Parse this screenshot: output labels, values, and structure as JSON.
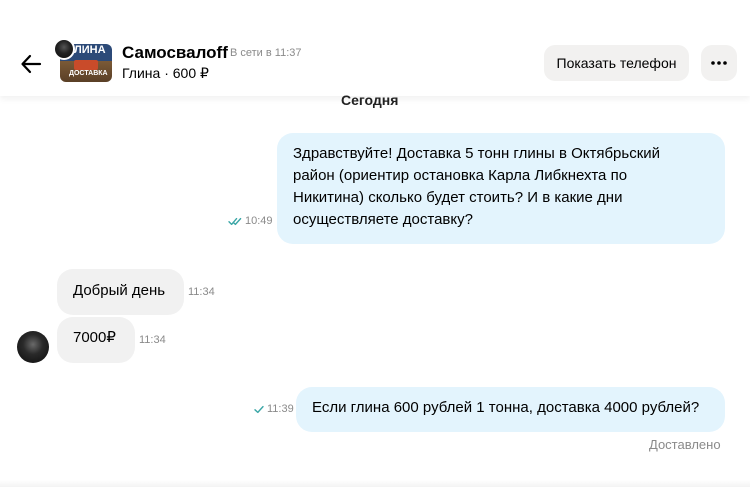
{
  "header": {
    "seller_name": "Самосвалоff",
    "online_status": "В сети в 11:37",
    "ad_info": "Глина · 600 ₽",
    "ad_thumb_title": "ЛИНА",
    "ad_thumb_subtitle": "ДОСТАВКА",
    "show_phone_label": "Показать телефон"
  },
  "chat": {
    "date_separator": "Сегодня",
    "messages": [
      {
        "direction": "outgoing",
        "lines": [
          "Здравствуйте! Доставка 5 тонн глины в Октябрьский",
          "район (ориентир остановка Карла Либкнехта по",
          "Никитина) сколько будет стоить? И в какие дни",
          "осуществляете доставку?"
        ],
        "time": "10:49",
        "status_icon": "double-check-icon"
      },
      {
        "direction": "incoming",
        "text": "Добрый день",
        "time": "11:34"
      },
      {
        "direction": "incoming",
        "text": "7000₽",
        "time": "11:34"
      },
      {
        "direction": "outgoing",
        "text": "Если глина 600 рублей 1 тонна, доставка 4000 рублей?",
        "time": "11:39",
        "status_icon": "single-check-icon"
      }
    ],
    "delivered_label": "Доставлено"
  },
  "colors": {
    "outgoing_bubble": "#e3f4fd",
    "incoming_bubble": "#f1f1f1",
    "check_mark": "#3aa6a6",
    "button_bg": "#f2f1f0"
  },
  "icons": {
    "back": "arrow-left-icon",
    "more": "more-horizontal-icon"
  }
}
